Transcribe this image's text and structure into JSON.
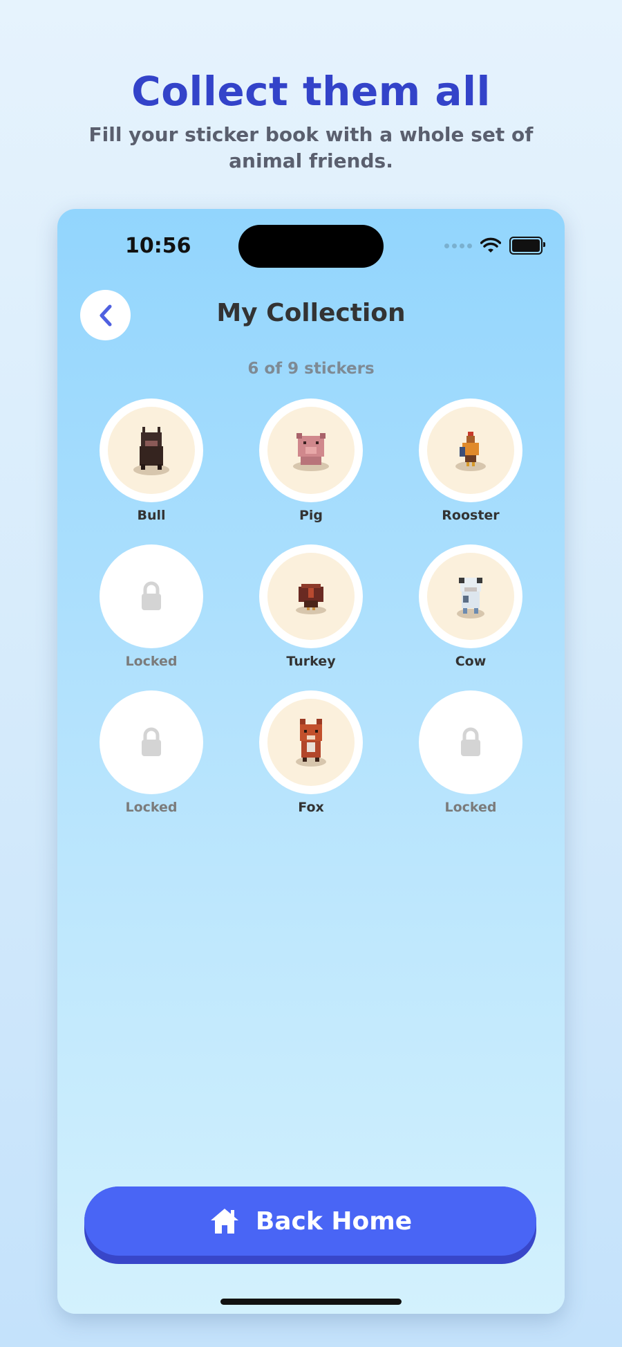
{
  "promo": {
    "headline": "Collect them all",
    "subheadline": "Fill your sticker book with a whole set of animal friends."
  },
  "status_bar": {
    "time": "10:56"
  },
  "header": {
    "title": "My Collection",
    "back_icon": "chevron-left-icon"
  },
  "collection": {
    "count_text": "6 of 9 stickers",
    "items": [
      {
        "label": "Bull",
        "locked": false
      },
      {
        "label": "Pig",
        "locked": false
      },
      {
        "label": "Rooster",
        "locked": false
      },
      {
        "label": "Locked",
        "locked": true
      },
      {
        "label": "Turkey",
        "locked": false
      },
      {
        "label": "Cow",
        "locked": false
      },
      {
        "label": "Locked",
        "locked": true
      },
      {
        "label": "Fox",
        "locked": false
      },
      {
        "label": "Locked",
        "locked": true
      }
    ]
  },
  "footer": {
    "home_button_label": "Back Home",
    "home_icon": "house-icon"
  },
  "colors": {
    "headline": "#3343c9",
    "button": "#4965f5",
    "sticker_bg": "#fbf0dc"
  }
}
